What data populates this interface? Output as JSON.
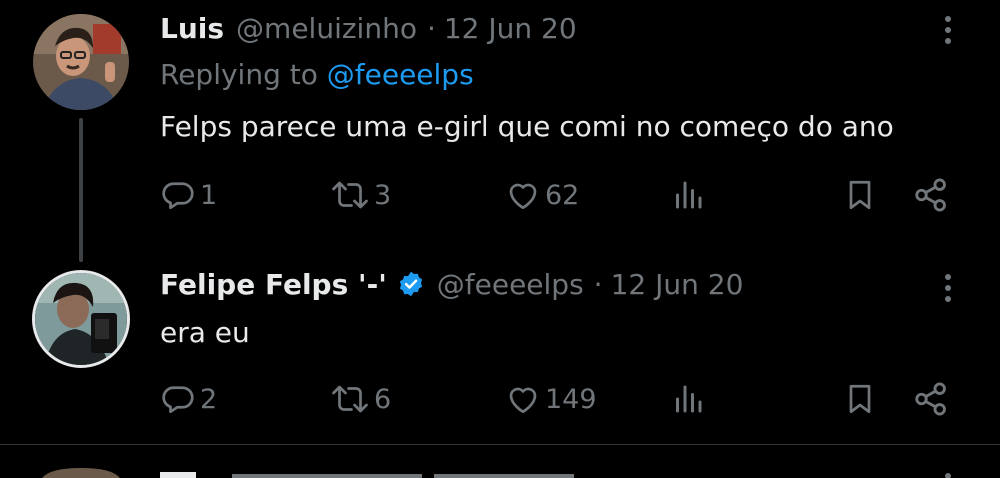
{
  "tweets": [
    {
      "name": "Luis",
      "handle": "@meluizinho",
      "separator": "·",
      "date": "12 Jun 20",
      "replying_prefix": "Replying to",
      "replying_to": "@feeeelps",
      "text": "Felps parece uma e-girl que comi no começo do ano",
      "replies": "1",
      "retweets": "3",
      "likes": "62"
    },
    {
      "name": "Felipe Felps '-'",
      "handle": "@feeeelps",
      "separator": "·",
      "date": "12 Jun 20",
      "verified": true,
      "text": "era eu",
      "replies": "2",
      "retweets": "6",
      "likes": "149"
    }
  ],
  "colors": {
    "background": "#000000",
    "text": "#e7e9ea",
    "muted": "#71767b",
    "accent": "#1d9bf0"
  },
  "icons": [
    "reply-icon",
    "retweet-icon",
    "like-icon",
    "views-icon",
    "bookmark-icon",
    "share-icon",
    "more-icon",
    "verified-badge-icon"
  ]
}
